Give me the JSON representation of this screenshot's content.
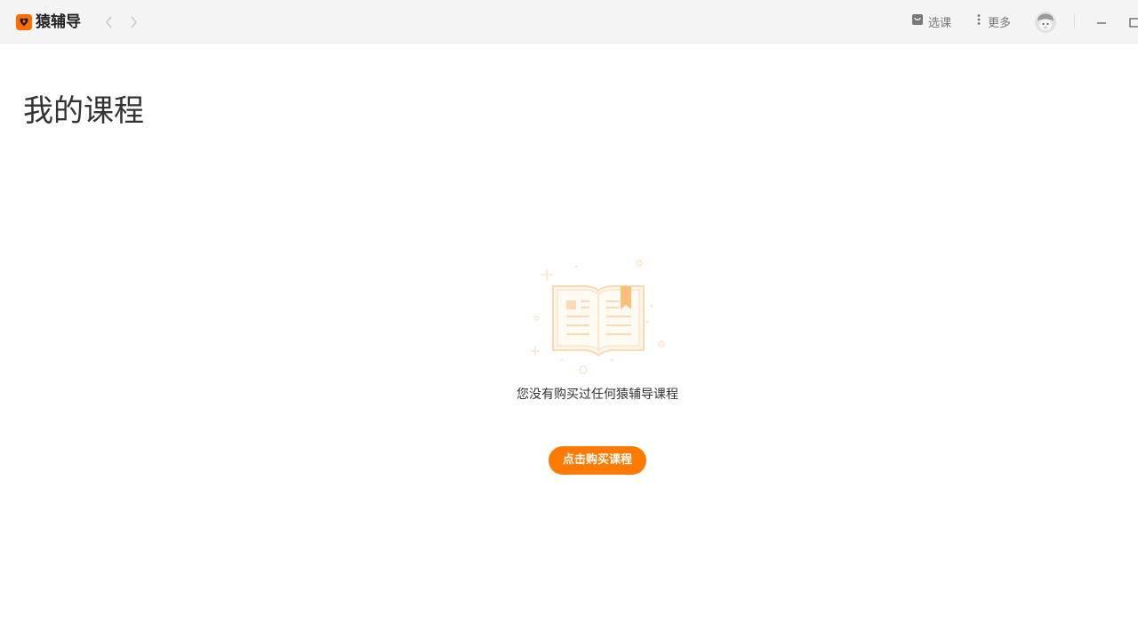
{
  "app": {
    "name": "猿辅导",
    "brand_color": "#ff6d00"
  },
  "titlebar": {
    "select_course_label": "选课",
    "select_course_icon": "bag-icon",
    "more_label": "更多",
    "more_icon": "vertical-dots-icon",
    "avatar_icon": "user-avatar-icon"
  },
  "main": {
    "title": "我的课程",
    "empty_state": {
      "illustration": "open-book-icon",
      "message": "您没有购买过任何猿辅导课程",
      "button_label": "点击购买课程",
      "button_color": "#ff7a00"
    }
  }
}
